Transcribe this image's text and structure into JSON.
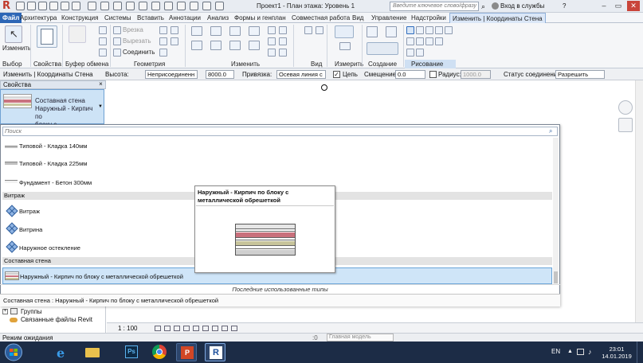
{
  "window": {
    "title": "Проект1 - План этажа: Уровень 1",
    "search_placeholder": "Введите ключевое слово/фразу",
    "login": "Вход в службы",
    "help": "?",
    "min": "–",
    "max": "▭",
    "close": "✕"
  },
  "tabs": [
    "Файл",
    "Архитектура",
    "Конструкция",
    "Системы",
    "Вставить",
    "Аннотации",
    "Анализ",
    "Формы и генплан",
    "Совместная работа",
    "Вид",
    "Управление",
    "Надстройки",
    "Изменить | Координаты Стена"
  ],
  "ribbon": {
    "modify": "Изменить",
    "select": "Выбор",
    "properties": "Свойства",
    "clipboard": "Буфер обмена",
    "cut": "Врезка",
    "cut2": "Вырезать",
    "join": "Соединить",
    "geometry": "Геометрия",
    "modify_panel": "Изменить",
    "view": "Вид",
    "measure": "Измерить",
    "create": "Создание",
    "draw": "Рисование"
  },
  "options_bar": {
    "context": "Изменить | Координаты Стена",
    "height_label": "Высота:",
    "height_value": "Неприсоединенн",
    "height_num": "8000.0",
    "location_label": "Привязка:",
    "location_value": "Осевая линия с",
    "chain_label": "Цепь",
    "offset_label": "Смещение:",
    "offset_value": "0.0",
    "radius_label": "Радиус:",
    "radius_value": "1000.0",
    "join_status_label": "Статус соединения:",
    "join_status_value": "Разрешить"
  },
  "properties": {
    "header": "Свойства",
    "close": "×",
    "type_line1": "Составная стена",
    "type_line2": "Наружный - Кирпич по",
    "type_line3": "блоку с металлическо..."
  },
  "dropdown": {
    "search_placeholder": "Поиск",
    "items": [
      {
        "label": "Типовой - Кладка 140мм"
      },
      {
        "label": "Типовой - Кладка 225мм"
      },
      {
        "label": "Фундамент - Бетон 300мм"
      }
    ],
    "group_curtain": "Витраж",
    "curtain_items": [
      {
        "label": "Витраж"
      },
      {
        "label": "Витрина"
      },
      {
        "label": "Наружное остекление"
      }
    ],
    "group_stacked": "Составная стена",
    "selected": "Наружный - Кирпич по блоку с металлической обрешеткой",
    "recent": "Последние использованные типы",
    "status": "Составная стена : Наружный - Кирпич по блоку с металлической обрешеткой"
  },
  "tooltip": {
    "title": "Наружный - Кирпич по блоку с металлической обрешеткой"
  },
  "browser": {
    "groups": "Группы",
    "links": "Связанные файлы Revit"
  },
  "view_bar": {
    "scale": "1 : 100"
  },
  "status_bar": {
    "text": "Режим ожидания",
    "model": "Главная модель",
    "zero": ":0"
  },
  "taskbar": {
    "lang": "EN",
    "time": "23:01",
    "date": "14.01.2019"
  }
}
